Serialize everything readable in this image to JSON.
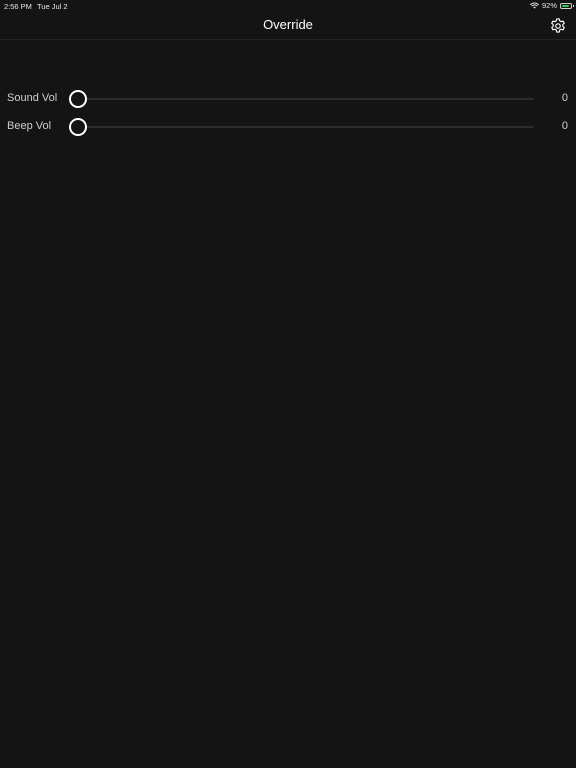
{
  "status_bar": {
    "time": "2:56 PM",
    "date": "Tue Jul 2",
    "battery_percent": "92%",
    "battery_level": 0.92,
    "battery_color": "#34c759",
    "wifi_icon": "wifi-icon",
    "battery_icon": "battery-icon"
  },
  "nav": {
    "title": "Override",
    "settings_icon": "gear-icon"
  },
  "sliders": [
    {
      "label": "Sound Vol",
      "value": "0",
      "level": 0
    },
    {
      "label": "Beep Vol",
      "value": "0",
      "level": 0
    }
  ],
  "colors": {
    "background": "#141414",
    "text": "#ffffff",
    "secondary_text": "#cfcfcf",
    "track": "#2c2c2e"
  }
}
